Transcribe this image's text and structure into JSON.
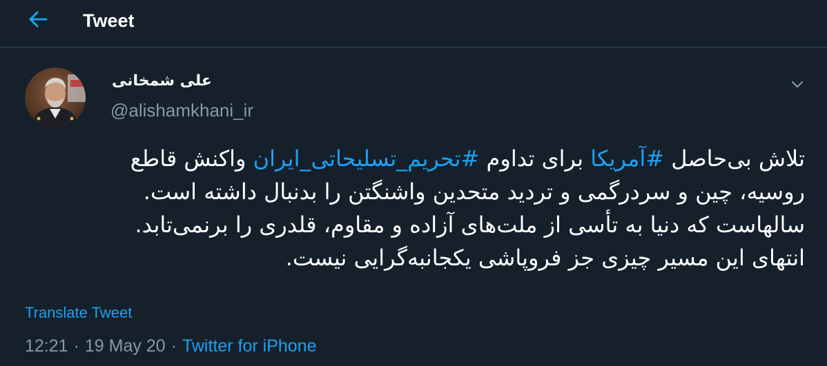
{
  "header": {
    "back_icon": "arrow-left-icon",
    "title": "Tweet"
  },
  "author": {
    "display_name": "علی شمخانی",
    "handle": "@alishamkhani_ir",
    "avatar_icon": "avatar"
  },
  "menu_icon": "chevron-down-icon",
  "tweet": {
    "line1": {
      "a": "تلاش بی‌حاصل ",
      "hashtag1": "#آمریکا",
      "b": " برای تداوم ",
      "hashtag2": "#تحریم_تسلیحاتی_ایران",
      "c": " واکنش قاطع"
    },
    "line2": "روسیه، چین و سردرگمی و تردید متحدین واشنگتن را بدنبال داشته است.",
    "line3": "سالهاست که دنیا به تأسی از ملت‌های آزاده و مقاوم، قلدری را برنمی‌تابد.",
    "line4": "انتهای این مسیر چیزی جز فروپاشی یکجانبه‌گرایی نیست."
  },
  "translate_label": "Translate Tweet",
  "meta": {
    "time": "12:21",
    "separator": "·",
    "date": "19 May 20",
    "source": "Twitter for iPhone"
  },
  "colors": {
    "background": "#15202b",
    "accent": "#1da1f2",
    "secondary_text": "#8899a6",
    "divider": "#38444d"
  }
}
